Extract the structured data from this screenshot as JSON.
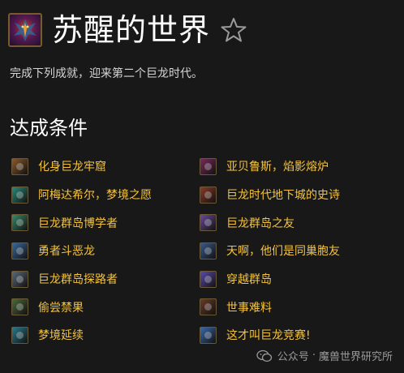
{
  "achievement": {
    "title": "苏醒的世界",
    "description": "完成下列成就，迎来第二个巨龙时代。",
    "icon": "dragon-icon",
    "favorite_icon": "star-outline-icon"
  },
  "criteria_heading": "达成条件",
  "criteria_color": "#f5c33b",
  "criteria": {
    "left": [
      {
        "label": "化身巨龙牢窟",
        "icon": "raid-icon",
        "color": "#8a5a2a"
      },
      {
        "label": "阿梅达希尔，梦境之愿",
        "icon": "dream-icon",
        "color": "#2a8a7a"
      },
      {
        "label": "巨龙群岛博学者",
        "icon": "lore-icon",
        "color": "#3a8a6a"
      },
      {
        "label": "勇者斗恶龙",
        "icon": "warrior-icon",
        "color": "#3a6a9a"
      },
      {
        "label": "巨龙群岛探路者",
        "icon": "pathfinder-icon",
        "color": "#5a6a7a"
      },
      {
        "label": "偷尝禁果",
        "icon": "fruit-icon",
        "color": "#4a6a3a"
      },
      {
        "label": "梦境延续",
        "icon": "dream-sprout-icon",
        "color": "#2a7a8a"
      }
    ],
    "right": [
      {
        "label": "亚贝鲁斯，焰影熔炉",
        "icon": "forge-icon",
        "color": "#7a2a5a"
      },
      {
        "label": "巨龙时代地下城的史诗",
        "icon": "dungeon-icon",
        "color": "#8a3a2a"
      },
      {
        "label": "巨龙群岛之友",
        "icon": "friend-icon",
        "color": "#6a4a9a"
      },
      {
        "label": "天啊，他们是同巢胞友",
        "icon": "nest-icon",
        "color": "#3a5a8a"
      },
      {
        "label": "穿越群岛",
        "icon": "travel-icon",
        "color": "#5a4aaa"
      },
      {
        "label": "世事难料",
        "icon": "world-icon",
        "color": "#6a3a2a"
      },
      {
        "label": "这才叫巨龙竞赛!",
        "icon": "race-icon",
        "color": "#3a6aaa"
      }
    ]
  },
  "watermark": {
    "icon": "wechat-icon",
    "prefix": "公众号",
    "separator": "·",
    "name": "魔兽世界研究所"
  }
}
